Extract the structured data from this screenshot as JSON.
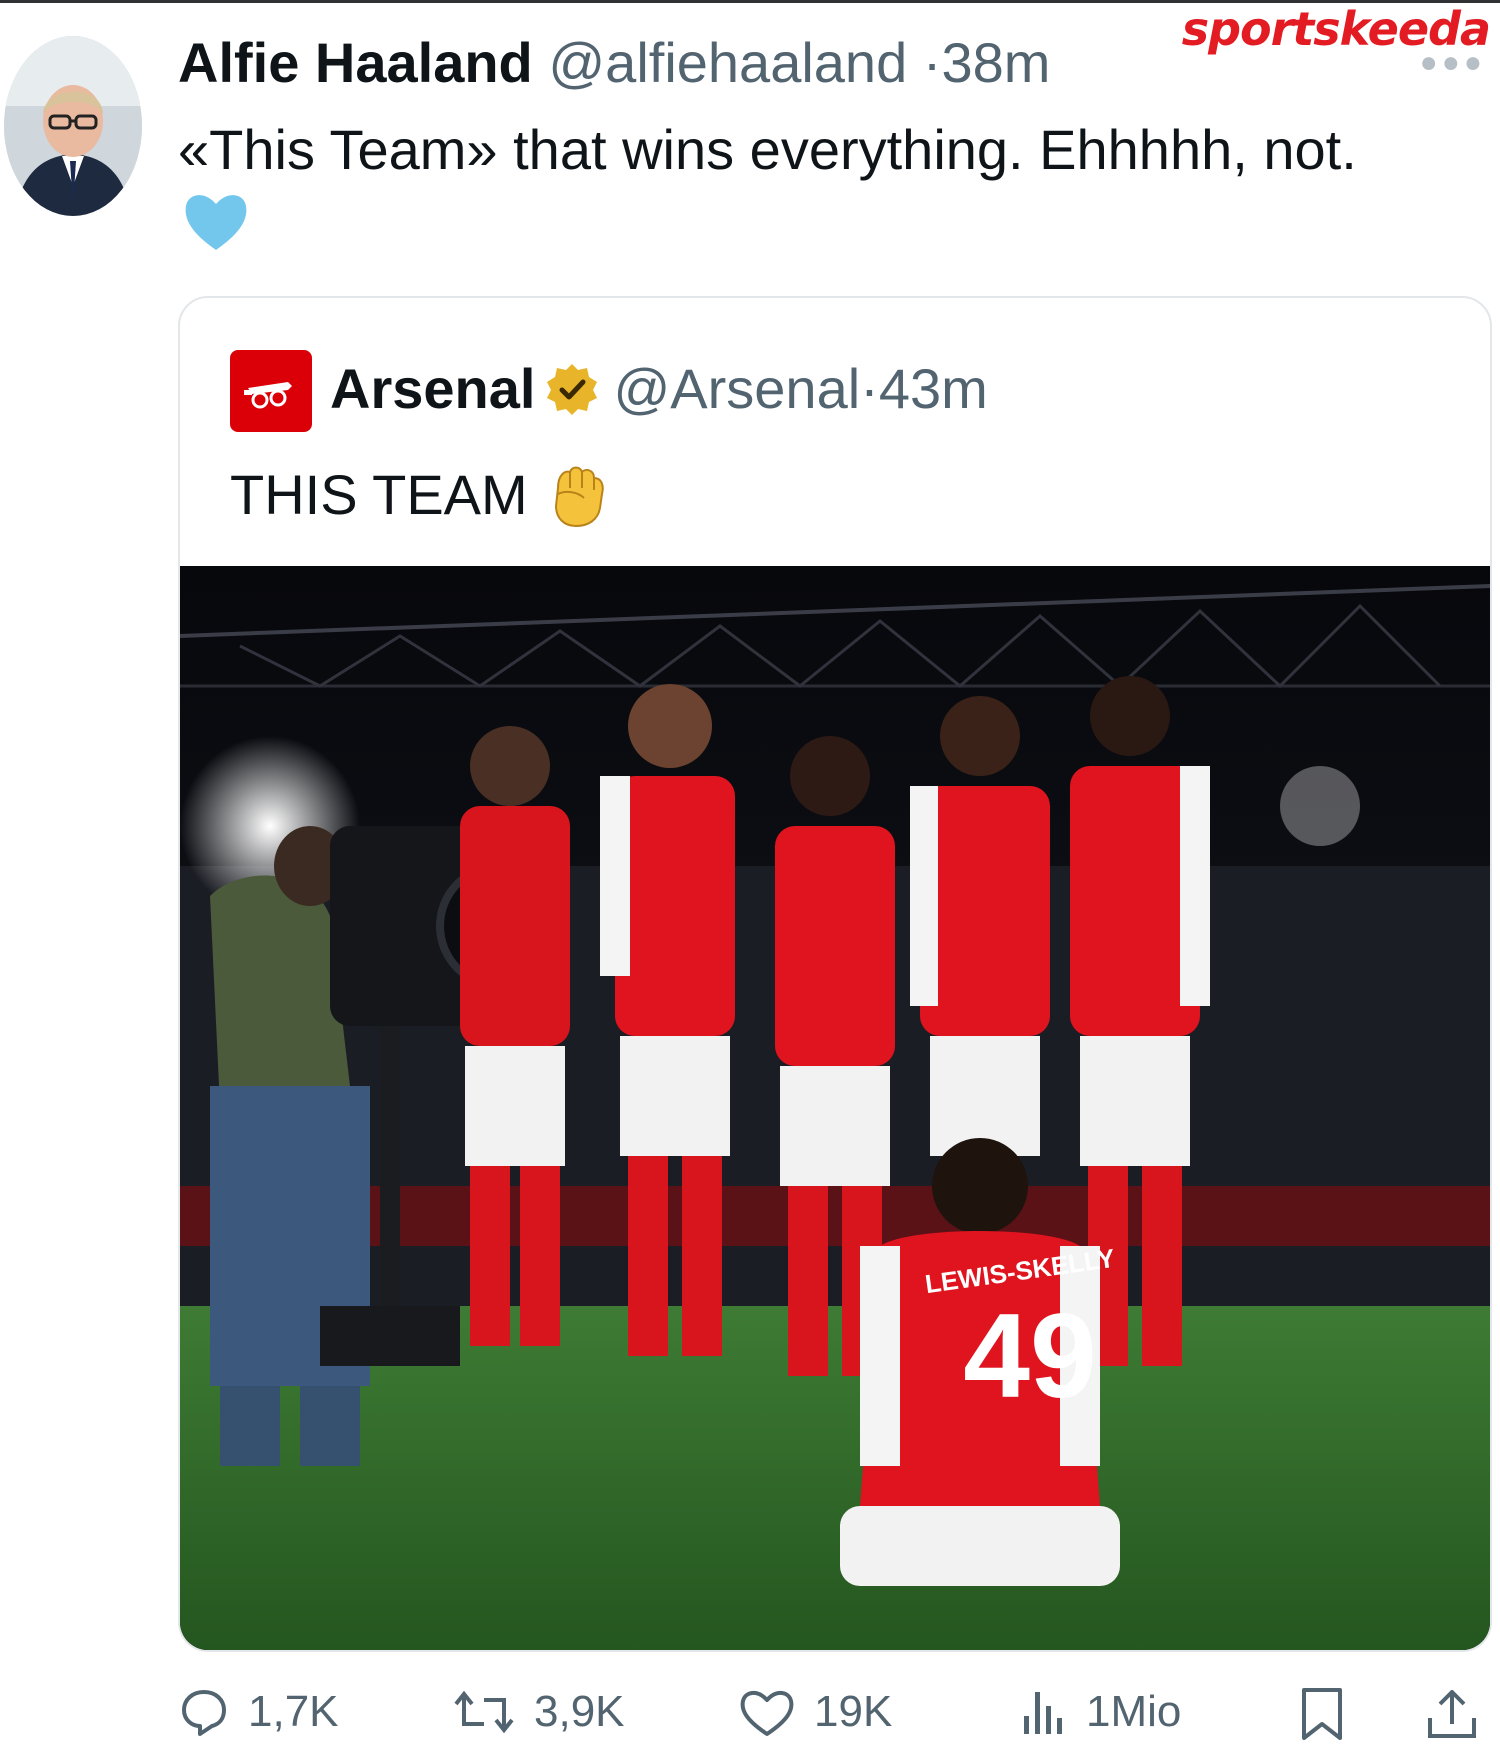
{
  "watermark": "sportskeeda",
  "tweet": {
    "author_name": "Alfie Haaland",
    "author_handle": "@alfiehaaland",
    "separator": "·",
    "time": "38m",
    "text": "«This Team» that wins everything. Ehhhhh, not.",
    "emoji": "light-blue-heart-icon"
  },
  "quoted_tweet": {
    "author_name": "Arsenal",
    "author_handle": "@Arsenal",
    "separator": "·",
    "time": "43m",
    "verified": "gold-verified-badge-icon",
    "text": "THIS TEAM",
    "emoji": "raised-fist-icon",
    "jersey_name": "LEWIS-SKELLY",
    "jersey_number": "49"
  },
  "actions": {
    "replies": "1,7K",
    "retweets": "3,9K",
    "likes": "19K",
    "views": "1Mio"
  },
  "colors": {
    "brand": "#e31b23",
    "arsenal_red": "#db0007",
    "secondary_text": "#536471",
    "pitch": "#2f6b2a"
  }
}
